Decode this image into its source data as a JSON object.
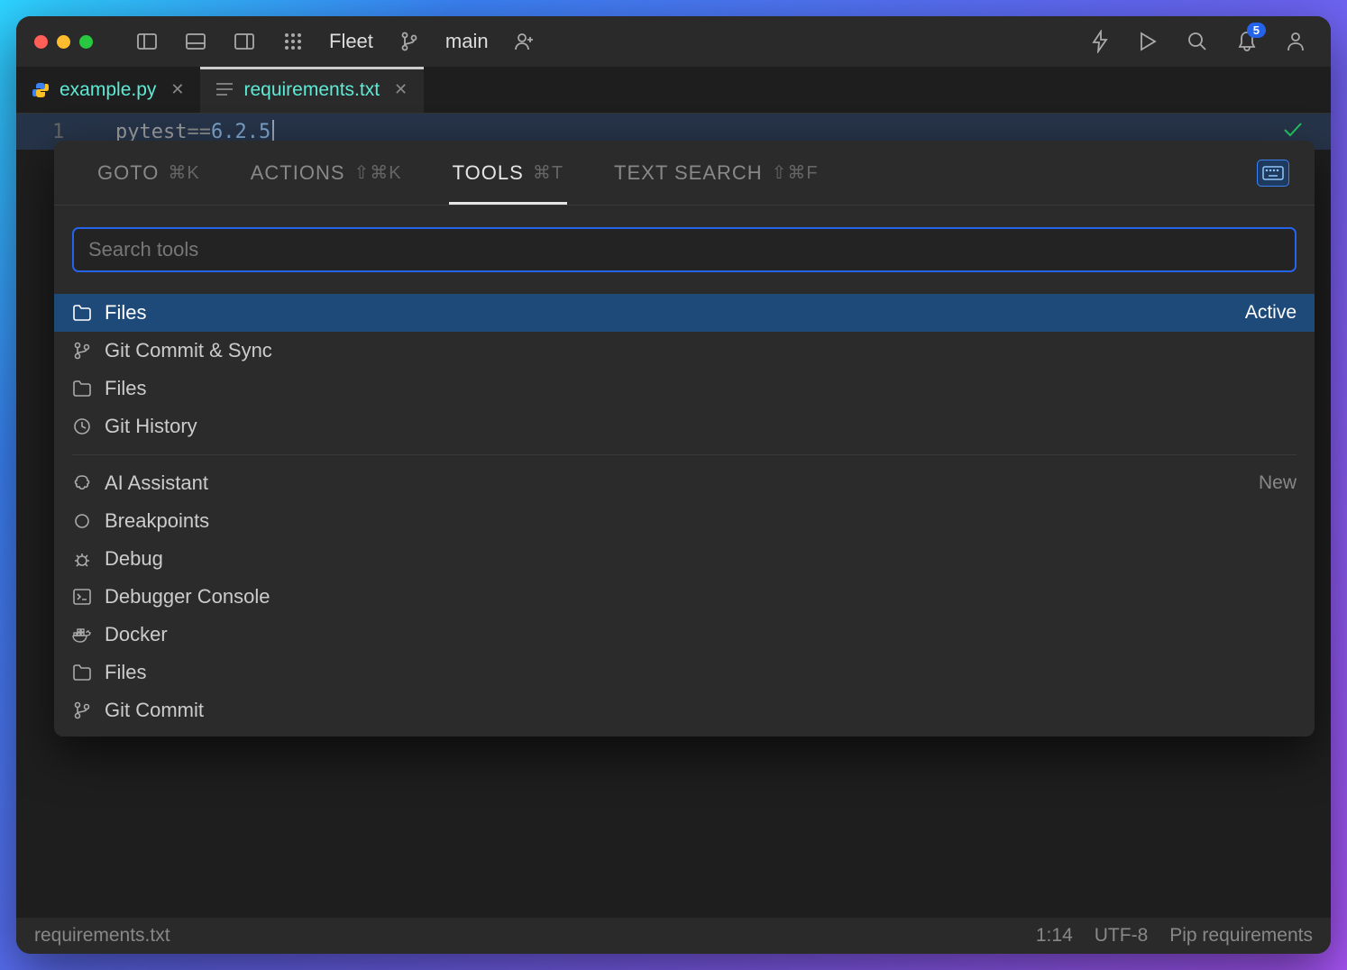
{
  "titlebar": {
    "app_name": "Fleet",
    "branch": "main",
    "notification_count": "5"
  },
  "tabs": [
    {
      "label": "example.py",
      "icon": "python"
    },
    {
      "label": "requirements.txt",
      "icon": "lines"
    }
  ],
  "editor": {
    "line_number": "1",
    "code_pkg": "pytest",
    "code_eq": "==",
    "code_ver": "6.2.5"
  },
  "palette": {
    "tabs": [
      {
        "label": "GOTO",
        "shortcut": "⌘K"
      },
      {
        "label": "ACTIONS",
        "shortcut": "⇧⌘K"
      },
      {
        "label": "TOOLS",
        "shortcut": "⌘T"
      },
      {
        "label": "TEXT SEARCH",
        "shortcut": "⇧⌘F"
      }
    ],
    "search_placeholder": "Search tools",
    "group1": [
      {
        "icon": "folder",
        "label": "Files",
        "badge": "Active",
        "selected": true
      },
      {
        "icon": "branch",
        "label": "Git Commit & Sync"
      },
      {
        "icon": "folder",
        "label": "Files"
      },
      {
        "icon": "clock",
        "label": "Git History"
      }
    ],
    "group2": [
      {
        "icon": "ai",
        "label": "AI Assistant",
        "badge": "New"
      },
      {
        "icon": "circle",
        "label": "Breakpoints"
      },
      {
        "icon": "debug",
        "label": "Debug"
      },
      {
        "icon": "console",
        "label": "Debugger Console"
      },
      {
        "icon": "docker",
        "label": "Docker"
      },
      {
        "icon": "folder",
        "label": "Files"
      },
      {
        "icon": "branch",
        "label": "Git Commit"
      }
    ]
  },
  "statusbar": {
    "filename": "requirements.txt",
    "position": "1:14",
    "encoding": "UTF-8",
    "filetype": "Pip requirements"
  }
}
